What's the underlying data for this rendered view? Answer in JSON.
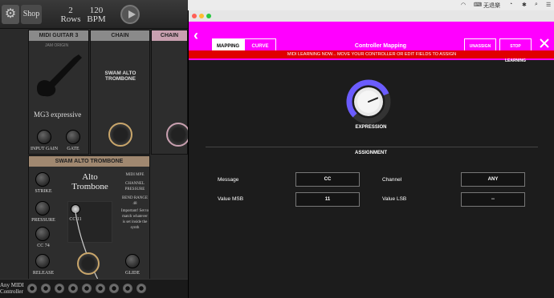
{
  "host": {
    "shop_label": "Shop",
    "rows_value": "2",
    "rows_label": "Rows",
    "bpm_value": "120",
    "bpm_label": "BPM",
    "panel_midi_guitar_title": "MIDI GUITAR 3",
    "panel_chain_title": "CHAIN",
    "panel_chain2_title": "CHAIN",
    "guitar_brand": "JAM ORIGIN",
    "guitar_preset": "MG3 expressive",
    "input_gain_label": "INPUT GAIN",
    "gate_label": "GATE",
    "chain_instrument": "SWAM ALTO TROMBONE",
    "swam_panel_title": "SWAM ALTO TROMBONE",
    "swam_name_line1": "Alto",
    "swam_name_line2": "Trombone",
    "swam_info": "MIDI MPE",
    "swam_channel_pressure": "CHANNEL PRESSURE",
    "swam_bend_range": "BEND RANGE 48",
    "swam_note": "Important! Set to match whatever is set inside the synth",
    "cc11_label": "CC 11",
    "strike_label": "STRIKE",
    "pressure_label": "PRESSURE",
    "cc74_label": "CC 74",
    "release_label": "RELEASE",
    "glide_label": "GLIDE",
    "any_midi_line1": "Any MIDI",
    "any_midi_line2": "Controller"
  },
  "menubar": {
    "input_method": "无退樂"
  },
  "mapping": {
    "back_label": "BACK",
    "tab_mapping": "MAPPING",
    "tab_curve": "CURVE",
    "title": "Controller Mapping",
    "unassign_label": "UNASSIGN",
    "stop_learning_label": "STOP LEARNING",
    "close_label": "CLOSE",
    "banner": "MIDI LEARNING NOW... MOVE YOUR CONTROLLER OR EDIT FIELDS TO ASSIGN",
    "knob_label": "EXPRESSION",
    "knob_value_fraction": 0.75,
    "assignment_label": "ASSIGNMENT",
    "message_label": "Message",
    "message_value": "CC",
    "channel_label": "Channel",
    "channel_value": "ANY",
    "value_msb_label": "Value MSB",
    "value_msb_value": "11",
    "value_lsb_label": "Value LSB",
    "value_lsb_value": "--"
  },
  "colors": {
    "header_magenta": "#ff00ff",
    "banner_red": "#e00000",
    "knob_arc": "#6b5cff"
  }
}
